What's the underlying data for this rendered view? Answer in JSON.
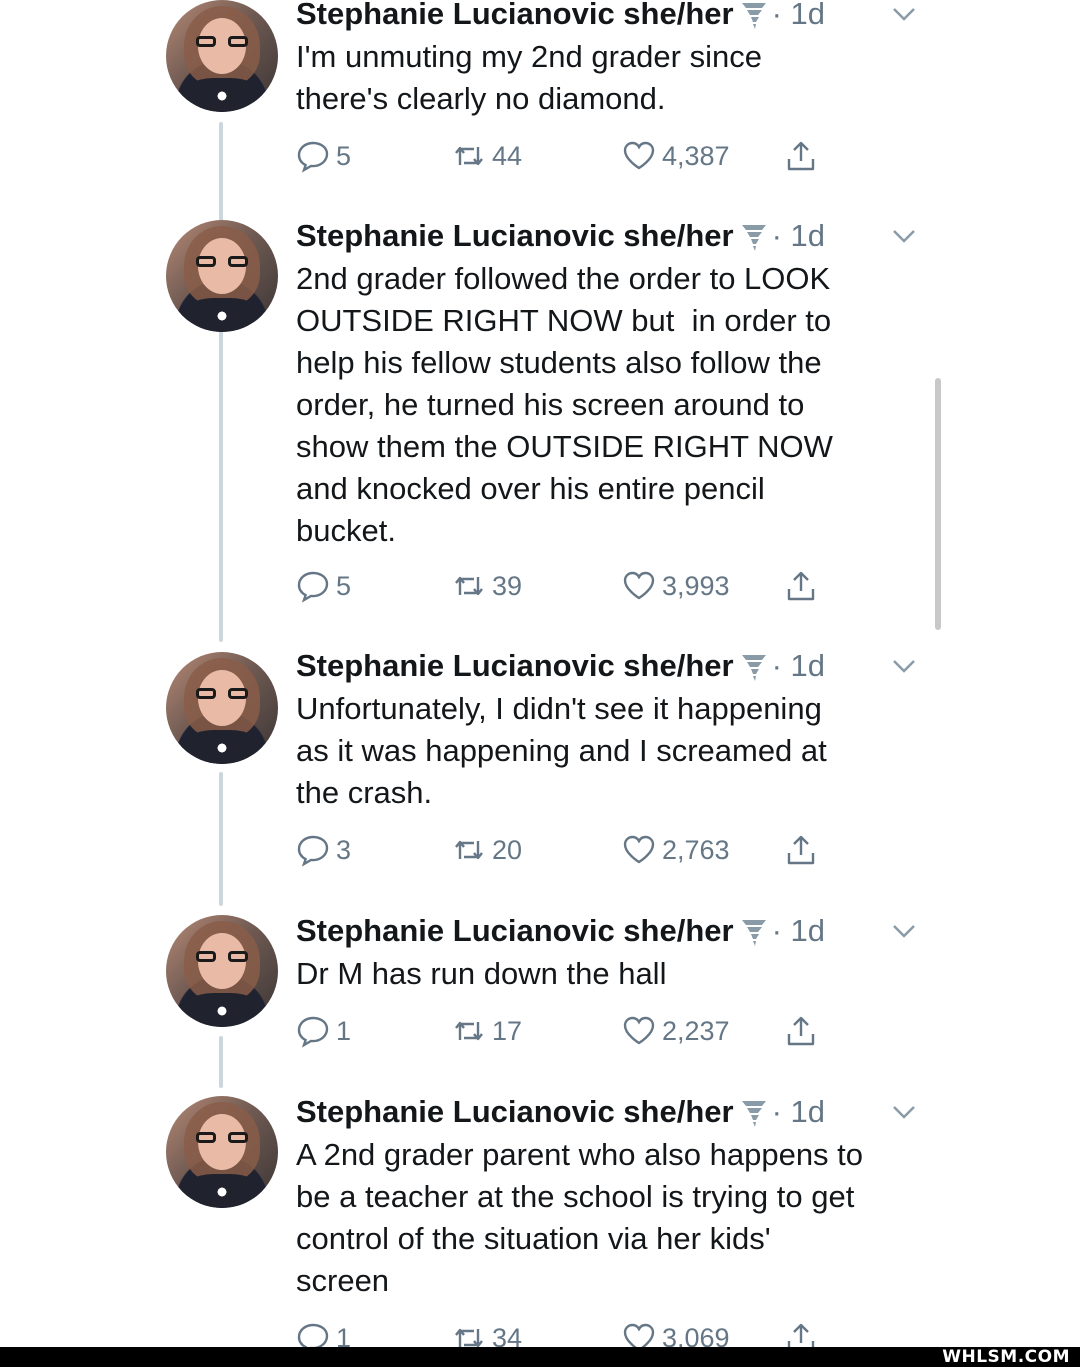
{
  "tweets": [
    {
      "author": "Stephanie Lucianovic she/her",
      "time": "· 1d",
      "text": "I'm unmuting my 2nd grader since\nthere's clearly no diamond.",
      "replies": "5",
      "retweets": "44",
      "likes": "4,387"
    },
    {
      "author": "Stephanie Lucianovic she/her",
      "time": "· 1d",
      "text": "2nd grader followed the order to LOOK\nOUTSIDE RIGHT NOW but  in order to\nhelp his fellow students also follow the\norder, he turned his screen around to\nshow them the OUTSIDE RIGHT NOW\nand knocked over his entire pencil\nbucket.",
      "replies": "5",
      "retweets": "39",
      "likes": "3,993"
    },
    {
      "author": "Stephanie Lucianovic she/her",
      "time": "· 1d",
      "text": "Unfortunately, I didn't see it happening\nas it was happening and I screamed at\nthe crash.",
      "replies": "3",
      "retweets": "20",
      "likes": "2,763"
    },
    {
      "author": "Stephanie Lucianovic she/her",
      "time": "· 1d",
      "text": "Dr M has run down the hall",
      "replies": "1",
      "retweets": "17",
      "likes": "2,237"
    },
    {
      "author": "Stephanie Lucianovic she/her",
      "time": "· 1d",
      "text": "A 2nd grader parent who also happens to\nbe a teacher at the school is trying to get\ncontrol of the situation via her kids'\nscreen",
      "replies": "1",
      "retweets": "34",
      "likes": "3,069"
    }
  ],
  "icons": {
    "badge": "tornado-icon",
    "caret": "chevron-down-icon",
    "reply": "reply-icon",
    "retweet": "retweet-icon",
    "like": "heart-icon",
    "share": "share-icon"
  },
  "watermark": "WHLSM.COM",
  "colors": {
    "text": "#14171a",
    "muted": "#657786",
    "thread_line": "#ccd6dd"
  }
}
